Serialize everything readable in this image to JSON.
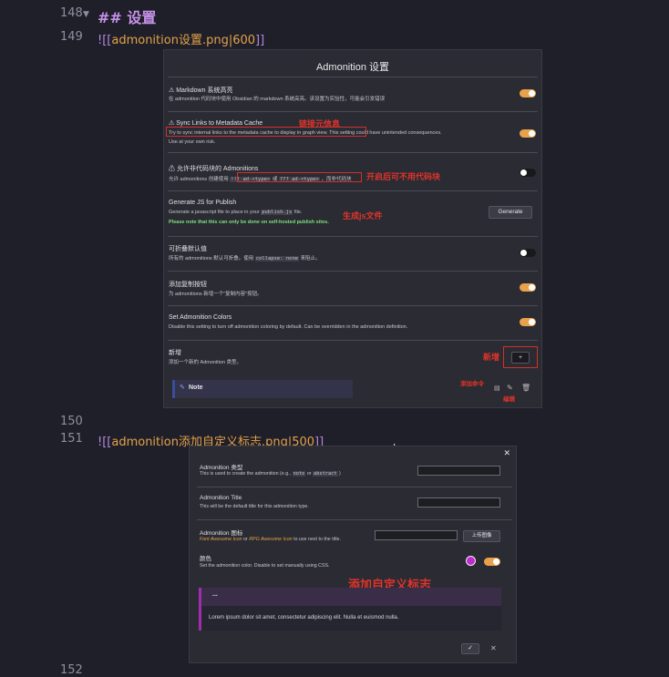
{
  "editor": {
    "line_numbers": [
      "148",
      "149",
      "150",
      "151",
      "152"
    ],
    "heading": "## 设置",
    "embed1_prefix": "![[",
    "embed1_name": "admonition设置.png|600",
    "embed1_suffix": "]]",
    "embed2_prefix": "![[",
    "embed2_name": "admonition添加自定义标志.png|500",
    "embed2_suffix": "]]"
  },
  "settings_panel": {
    "title": "Admonition 设置",
    "rows": [
      {
        "title": "⚠ Markdown 系统高亮",
        "desc": "在 admonition 代码块中使用 Obsidian 的 markdown 系统高亮。该设置为实验性，可能会引发错误",
        "toggle": "on"
      },
      {
        "title": "⚠ Sync Links to Metadata Cache",
        "desc": "Try to sync internal links to the metadata cache to display in graph view. This setting could have unintended consequences.",
        "desc2": "Use at your own risk.",
        "toggle": "on"
      },
      {
        "title": "⚠ 允许非代码块的 Admonitions",
        "desc_a": "允许 admonitions 创建使用",
        "chip1": "!!! ad-<type>",
        "desc_b": "或",
        "chip2": "??? ad-<type>",
        "desc_c": "，而非代码块",
        "toggle": "off"
      },
      {
        "title": "Generate JS for Publish",
        "desc_a": "Generate a javascript file to place in your",
        "chip1": "publish.js",
        "desc_b": "file.",
        "desc2": "Please note that this can only be done on self-hosted publish sites.",
        "button": "Generate"
      },
      {
        "title": "可折叠默认值",
        "desc_a": "所有的 admonitions 默认可折叠。使用",
        "chip1": "collapse: none",
        "desc_b": "来阻止。",
        "toggle": "off"
      },
      {
        "title": "添加复制按钮",
        "desc": "为 admonitions 新增一个\"复制内容\"按钮。",
        "toggle": "on"
      },
      {
        "title": "Set Admonition Colors",
        "desc": "Disable this setting to turn off admonition coloring by default. Can be overridden in the admonition definition.",
        "toggle": "on"
      },
      {
        "title": "新增",
        "desc": "添加一个新的 Admonition 类型。",
        "button": "+"
      }
    ],
    "note_item": "Note",
    "annotations": {
      "sync_links": "链接元信息",
      "non_codeblock": "开启后可不用代码块",
      "generate_js": "生成js文件",
      "add_new": "新增",
      "add_command": "添加命令",
      "edit": "编辑"
    }
  },
  "custom_panel": {
    "close": "✕",
    "type_label": "Admonition 类型",
    "type_desc_a": "This is used to create the admonition (e.g.,",
    "type_chip1": "note",
    "type_desc_b": "or",
    "type_chip2": "abstract",
    "type_desc_c": ")",
    "title_label": "Admonition Title",
    "title_desc": "This will be the default title for this admonition type.",
    "icon_label": "Admonition 图标",
    "icon_link1": "Font Awesome Icon",
    "icon_or": "or",
    "icon_link2": "RPG Awesome Icon",
    "icon_desc": "to use next to the title.",
    "upload_button": "上传图像",
    "color_label": "颜色",
    "color_desc": "Set the admonition color. Disable to set manually using CSS.",
    "color_swatch": "#c02ad0",
    "annotation": "添加自定义标志",
    "preview_title": "...",
    "preview_body": "Lorem ipsum dolor sit amet, consectetur adipiscing elit. Nulla et euismod nulla.",
    "ok": "✓",
    "cancel": "✕"
  }
}
